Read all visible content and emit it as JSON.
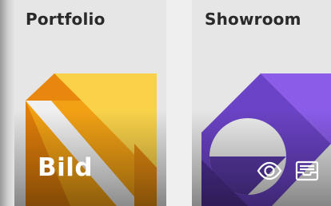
{
  "cards": [
    {
      "title": "Portfolio",
      "badge": "Bild",
      "colors": {
        "dark": "#e8870e",
        "mid": "#f5b21b",
        "light": "#f9d24a",
        "stripe": "#eeeeee"
      }
    },
    {
      "title": "Showroom",
      "icons": [
        "eye-icon",
        "tray-icon"
      ],
      "colors": {
        "dark": "#5a3aa8",
        "mid": "#6e44c9",
        "light": "#8b5df0",
        "circle": "#ececec"
      }
    }
  ]
}
